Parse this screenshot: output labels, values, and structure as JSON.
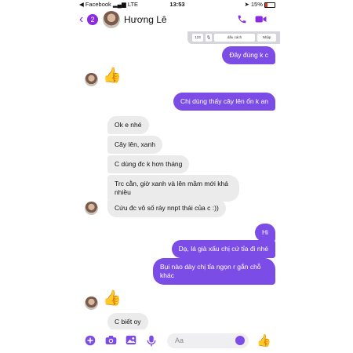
{
  "status_bar": {
    "carrier": "◀ Facebook",
    "network": "LTE",
    "time": "13:53",
    "battery": "15%"
  },
  "header": {
    "badge_count": "2",
    "contact_name": "Hương Lê",
    "icons": [
      "back-chevron-icon",
      "phone-icon",
      "video-camera-icon"
    ]
  },
  "keyboard_strip": {
    "key_123": "123",
    "key_space": "dấu cách",
    "key_return": "Nhập"
  },
  "messages": [
    {
      "from": "me",
      "text": "Đây đúng k c"
    },
    {
      "from": "contact",
      "type": "like"
    },
    {
      "from": "me",
      "text": "Chị dùng thấy cây lên ổn k an"
    },
    {
      "from": "contact",
      "text": "Ok e nhé"
    },
    {
      "from": "contact",
      "text": "Cây lên, xanh"
    },
    {
      "from": "contact",
      "text": "C dùng đc k hơn tháng"
    },
    {
      "from": "contact",
      "text": "Trc cằn, giờ xanh và lên mầm mới khá nhiều"
    },
    {
      "from": "contact",
      "text": "Cứu đc vô số ráy nnpt thái của c :))"
    },
    {
      "from": "me",
      "text": "Hi"
    },
    {
      "from": "me",
      "text": "Dạ, lá già xấu chị cứ tỉa đi nhé"
    },
    {
      "from": "me",
      "text": "Bụi nào dày chị tỉa ngọn r gắn chỗ khác"
    },
    {
      "from": "contact",
      "type": "like"
    },
    {
      "from": "contact",
      "text": "C biết oy"
    }
  ],
  "composer": {
    "placeholder": "Aa",
    "icons": [
      "plus-icon",
      "camera-icon",
      "gallery-icon",
      "microphone-icon",
      "emoji-icon",
      "thumbs-up-icon"
    ]
  },
  "colors": {
    "accent": "#7b4ce6",
    "incoming_bubble": "#ebebeb"
  }
}
